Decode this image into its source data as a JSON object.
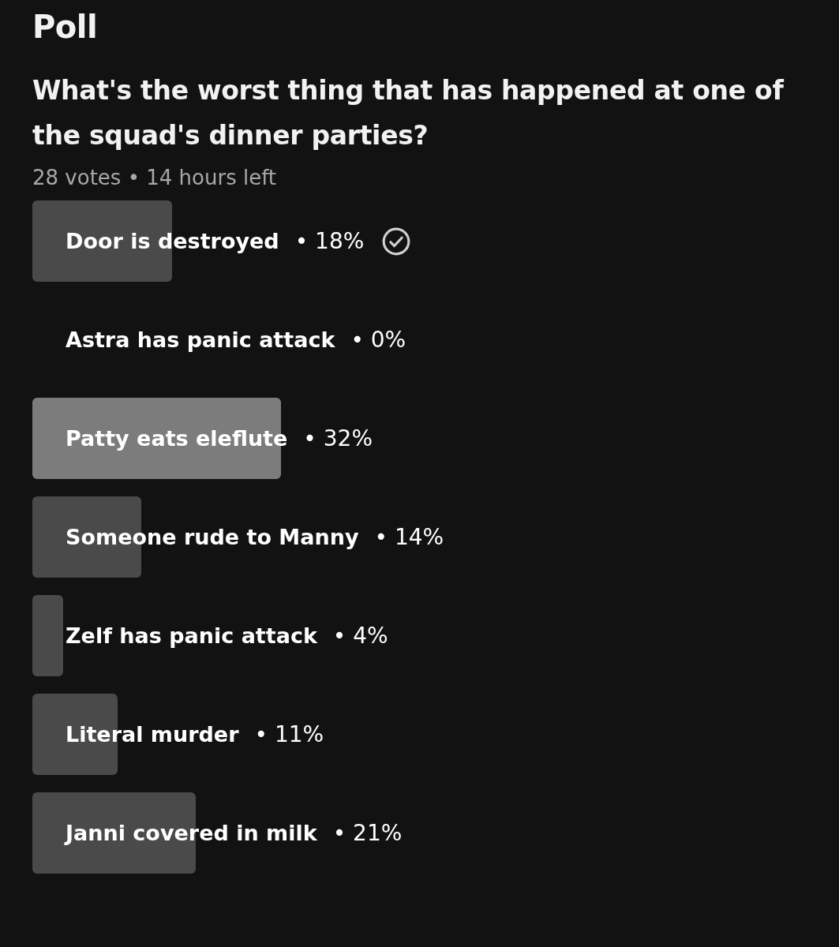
{
  "title": "Poll",
  "question": "What's the worst thing that has happened at one of the squad's dinner parties?",
  "meta": "28 votes • 14 hours left",
  "options": [
    {
      "label": "Door is destroyed",
      "percent": "• 18%",
      "level": 0.18,
      "selected": true
    },
    {
      "label": "Astra has panic attack",
      "percent": "• 0%",
      "level": 0,
      "selected": false
    },
    {
      "label": "Patty eats eleflute",
      "percent": "• 32%",
      "level": 0.32,
      "selected": false
    },
    {
      "label": "Someone rude to Manny",
      "percent": "• 14%",
      "level": 0.14,
      "selected": false
    },
    {
      "label": "Zelf has panic attack",
      "percent": "• 4%",
      "level": 0.04,
      "selected": false
    },
    {
      "label": "Literal murder",
      "percent": "• 11%",
      "level": 0.11,
      "selected": false
    },
    {
      "label": "Janni covered in milk",
      "percent": "• 21%",
      "level": 0.21,
      "selected": false
    }
  ]
}
